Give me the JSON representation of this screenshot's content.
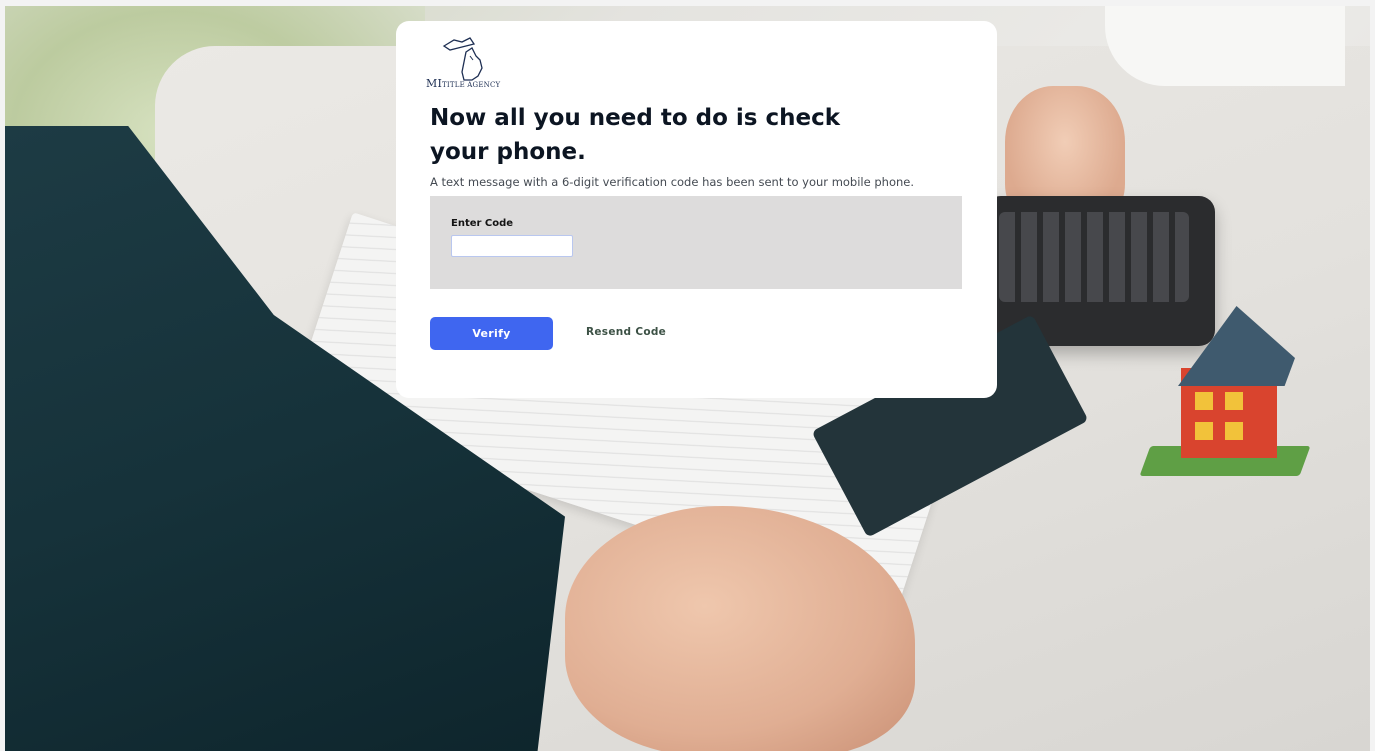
{
  "brand": {
    "logo_mi": "MI",
    "logo_rest": "TITLE AGENCY",
    "logo_color": "#1e2f53"
  },
  "card": {
    "title": "Now all you need to do is check your phone.",
    "subtitle": "A text message with a 6-digit verification code has been sent to your mobile phone."
  },
  "code_form": {
    "label": "Enter Code",
    "input_value": "",
    "input_placeholder": ""
  },
  "actions": {
    "verify_label": "Verify",
    "resend_label": "Resend Code"
  },
  "colors": {
    "accent": "#3f66f0",
    "panel": "#dddcdc",
    "resend": "#3c5145"
  }
}
